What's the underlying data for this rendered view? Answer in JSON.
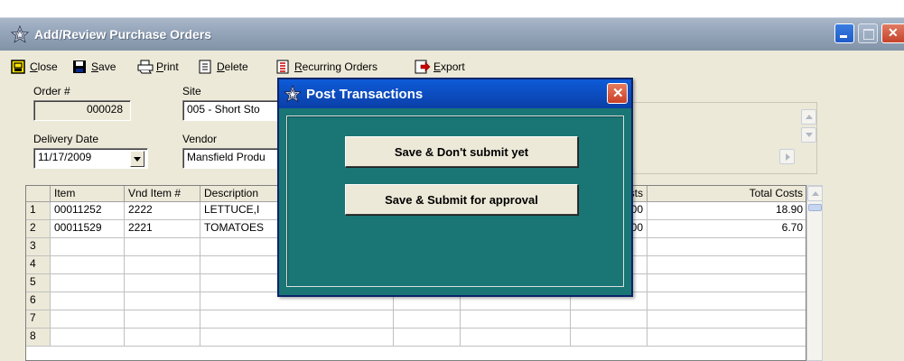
{
  "window": {
    "title": "Add/Review Purchase Orders",
    "icon": "star-icon"
  },
  "toolbar": {
    "close": {
      "pre": "",
      "u": "C",
      "post": "lose",
      "icon": "close-door-icon"
    },
    "save": {
      "pre": "",
      "u": "S",
      "post": "ave",
      "icon": "floppy-disk-icon"
    },
    "print": {
      "pre": "",
      "u": "P",
      "post": "rint",
      "icon": "printer-icon"
    },
    "delete": {
      "pre": "",
      "u": "D",
      "post": "elete",
      "icon": "delete-doc-icon"
    },
    "recurring": {
      "pre": "",
      "u": "R",
      "post": "ecurring Orders",
      "icon": "list-doc-icon"
    },
    "export": {
      "pre": "",
      "u": "E",
      "post": "xport",
      "icon": "export-icon"
    }
  },
  "form": {
    "order_label": "Order #",
    "order_value": "000028",
    "site_label": "Site",
    "site_value": "005 - Short Sto",
    "delivery_label": "Delivery Date",
    "delivery_value": "11/17/2009",
    "vendor_label": "Vendor",
    "vendor_value": "Mansfield Produ"
  },
  "grid": {
    "columns": {
      "item": "Item",
      "vnd": "Vnd Item #",
      "desc": "Description",
      "costs_partial": "sts",
      "total": "Total Costs"
    },
    "rows": [
      {
        "num": "1",
        "item": "00011252",
        "vnd": "2222",
        "desc": "LETTUCE,I",
        "cost_partial": "00",
        "total": "18.90"
      },
      {
        "num": "2",
        "item": "00011529",
        "vnd": "2221",
        "desc": "TOMATOES",
        "cost_partial": "00",
        "total": "6.70"
      },
      {
        "num": "3",
        "item": "",
        "vnd": "",
        "desc": "",
        "cost_partial": "",
        "total": ""
      },
      {
        "num": "4",
        "item": "",
        "vnd": "",
        "desc": "",
        "cost_partial": "",
        "total": ""
      },
      {
        "num": "5",
        "item": "",
        "vnd": "",
        "desc": "",
        "cost_partial": "",
        "total": ""
      },
      {
        "num": "6",
        "item": "",
        "vnd": "",
        "desc": "",
        "cost_partial": "",
        "total": ""
      },
      {
        "num": "7",
        "item": "",
        "vnd": "",
        "desc": "",
        "cost_partial": "",
        "total": ""
      },
      {
        "num": "8",
        "item": "",
        "vnd": "",
        "desc": "",
        "cost_partial": "",
        "total": ""
      }
    ]
  },
  "dialog": {
    "title": "Post Transactions",
    "save_dont_submit": "Save & Don't submit yet",
    "save_submit": "Save & Submit for approval",
    "bg_color": "#1a7575"
  }
}
